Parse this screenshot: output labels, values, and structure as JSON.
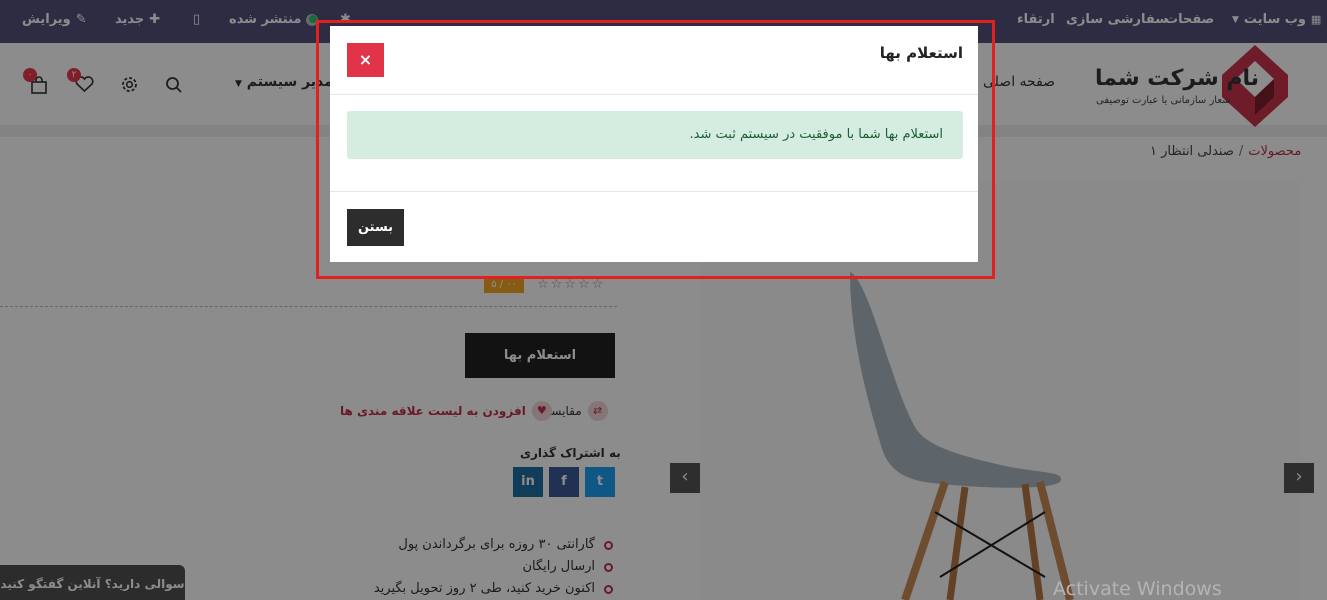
{
  "admin_bar": {
    "website": "وب سایت",
    "pages": "صفحات",
    "customize": "سفارشی سازی",
    "upgrade": "ارتقاء",
    "published": "منتشر شده",
    "new": "جدید",
    "edit": "ویرایش"
  },
  "header": {
    "logo_name": "نام شرکت شما",
    "logo_tagline": "شعار سازمانی یا عبارت توصیفی",
    "menu_home": "صفحه اصلی",
    "menu_admin": "مدیر سیستم",
    "wishlist_count": "۲",
    "cart_count": "۰"
  },
  "breadcrumb": {
    "root": "محصولات",
    "separator": "/",
    "current": "صندلی انتظار ۱"
  },
  "product": {
    "rating": "۵ / ۰۰",
    "inquiry_button": "استعلام بها",
    "compare": "مقایسه",
    "wishlist": "افزودن به لیست علاقه مندی ها",
    "share_title": "به اشتراک گذاری",
    "share_linkedin": "in",
    "share_facebook": "f",
    "share_twitter": "t",
    "bullets": [
      "گارانتی ۳۰ روزه برای برگرداندن پول",
      "ارسال رایگان",
      "اکنون خرید کنید، طی ۲ روز تحویل بگیرید"
    ]
  },
  "chat": {
    "label": "سوالی دارید؟ آنلاین گفتگو کنید"
  },
  "watermark": "Activate Windows",
  "modal": {
    "title": "استعلام بها",
    "close_icon": "×",
    "message": "استعلام بها شما با موفقیت در سیستم ثبت شد.",
    "close_button": "بستن"
  },
  "colors": {
    "admin_bar": "#52507a",
    "accent": "#c0314a",
    "danger": "#e23448",
    "success_bg": "#d5ede0",
    "highlight_frame": "#e2201f"
  }
}
